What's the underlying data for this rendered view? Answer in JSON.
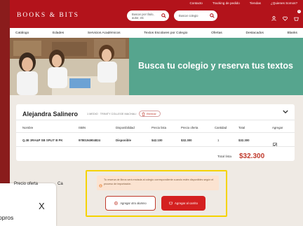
{
  "toplinks": [
    "Contacto",
    "Tracking de pedido",
    "Tiendas",
    "¿Quienes Somos?"
  ],
  "logo": "BOOKS & BITS",
  "search": {
    "books_placeholder": "Buscar por título, autor, etc",
    "school_placeholder": "Buscar colegio"
  },
  "cart_count": "0",
  "nav": [
    "Catálogo",
    "Edades",
    "Servicios Académicos",
    "Textos Escolares por Colegio",
    "Ofertas",
    "Destacados",
    "Blanks"
  ],
  "hero": {
    "title": "Busca tu colegio y reserva tus textos"
  },
  "student": {
    "name": "Alejandra Salinero",
    "grade": "1 MEDIO",
    "school": "TRINITY COLLEGE MACHALI",
    "remove_label": "Eliminar"
  },
  "table": {
    "headers": [
      "Nombre",
      "ISBN",
      "Disponibilidad",
      "Precio lista",
      "Precio oferta",
      "Cantidad",
      "Total",
      "Agregar"
    ],
    "row": {
      "name": "Q.3E 3RA&P SB SPLIT B PK",
      "isbn": "9780194904824",
      "availability": "Disponible",
      "list_price": "$42.100",
      "offer_price": "$32.300",
      "quantity": "1",
      "total": "$32.300",
      "selected": true
    },
    "total_label": "Total lista",
    "total_value": "$32.300"
  },
  "notice": "Tu reserva de libros será enviada al colegio correspondiente cuando estén disponibles según el proceso de importación.",
  "buttons": {
    "add_student": "Agregar otro alumno",
    "add_cart": "Agregar al carrito"
  },
  "overlay": {
    "header": "Precio oferta",
    "header_fragment": "Ca",
    "close": "X",
    "text": "opros"
  },
  "colors": {
    "brand": "#b3131b",
    "hero": "#56a58e",
    "highlight": "#f5d300",
    "price": "#c0392b"
  }
}
